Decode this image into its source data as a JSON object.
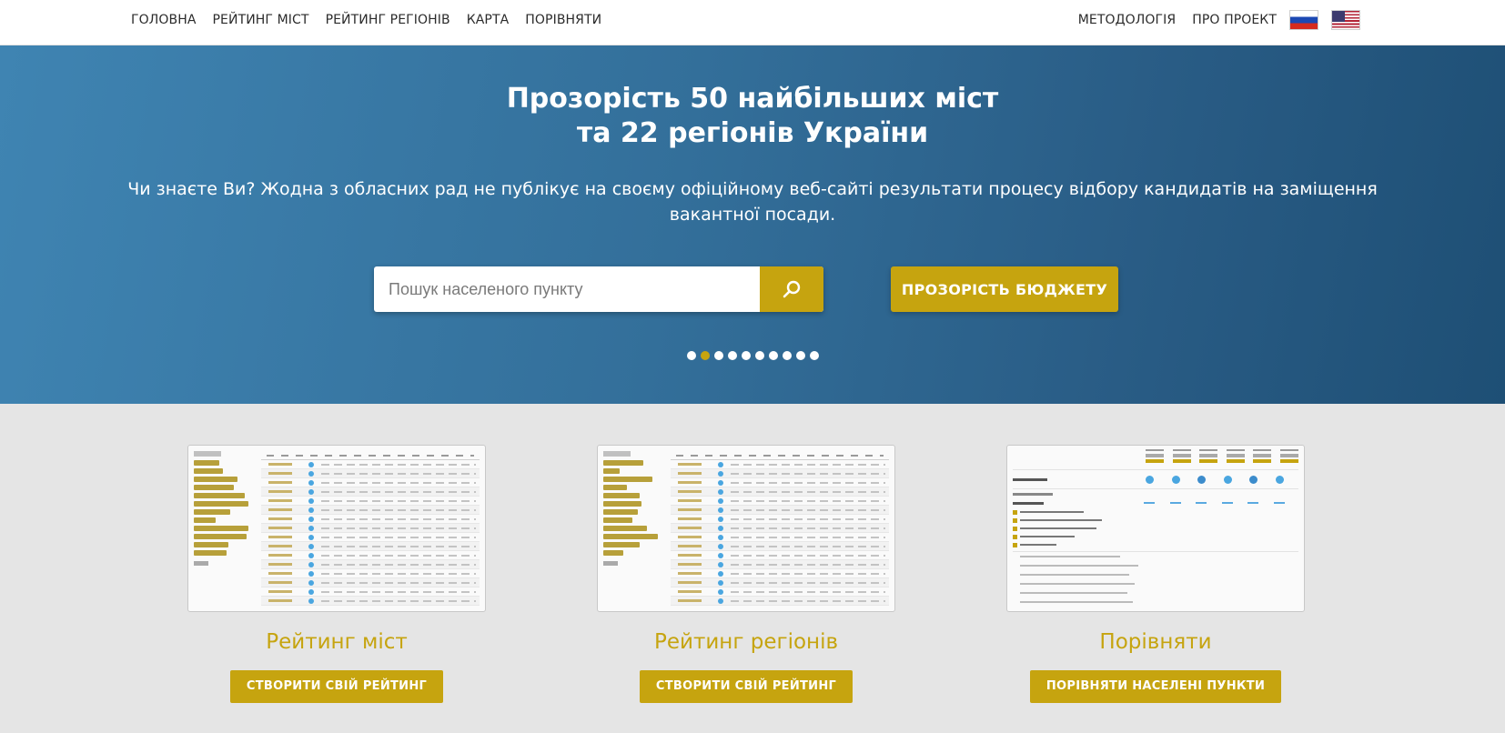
{
  "nav": {
    "left": [
      "ГОЛОВНА",
      "РЕЙТИНГ МІСТ",
      "РЕЙТИНГ РЕГІОНІВ",
      "КАРТА",
      "ПОРІВНЯТИ"
    ],
    "right": [
      "МЕТОДОЛОГІЯ",
      "ПРО ПРОЕКТ"
    ],
    "flags": [
      "russia-flag-icon",
      "usa-flag-icon"
    ]
  },
  "hero": {
    "title_line1": "Прозорість 50 найбільших міст",
    "title_line2": "та 22 регіонів України",
    "fact": "Чи знаєте Ви? Жодна з обласних рад не публікує на своєму офіційному веб-сайті результати процесу відбору кандидатів на заміщення вакантної посади.",
    "search_placeholder": "Пошук населеного пункту",
    "search_icon": "search-icon",
    "budget_button": "ПРОЗОРІСТЬ БЮДЖЕТУ",
    "slides_total": 10,
    "slide_active": 2
  },
  "cards": [
    {
      "title": "Рейтинг міст",
      "button": "СТВОРИТИ СВІЙ РЕЙТИНГ"
    },
    {
      "title": "Рейтинг регіонів",
      "button": "СТВОРИТИ СВІЙ РЕЙТИНГ"
    },
    {
      "title": "Порівняти",
      "button": "ПОРІВНЯТИ НАСЕЛЕНІ ПУНКТИ"
    }
  ],
  "colors": {
    "accent": "#c6a40f",
    "hero_blue": "#336f9a",
    "page_bg": "#e5e5e5"
  }
}
